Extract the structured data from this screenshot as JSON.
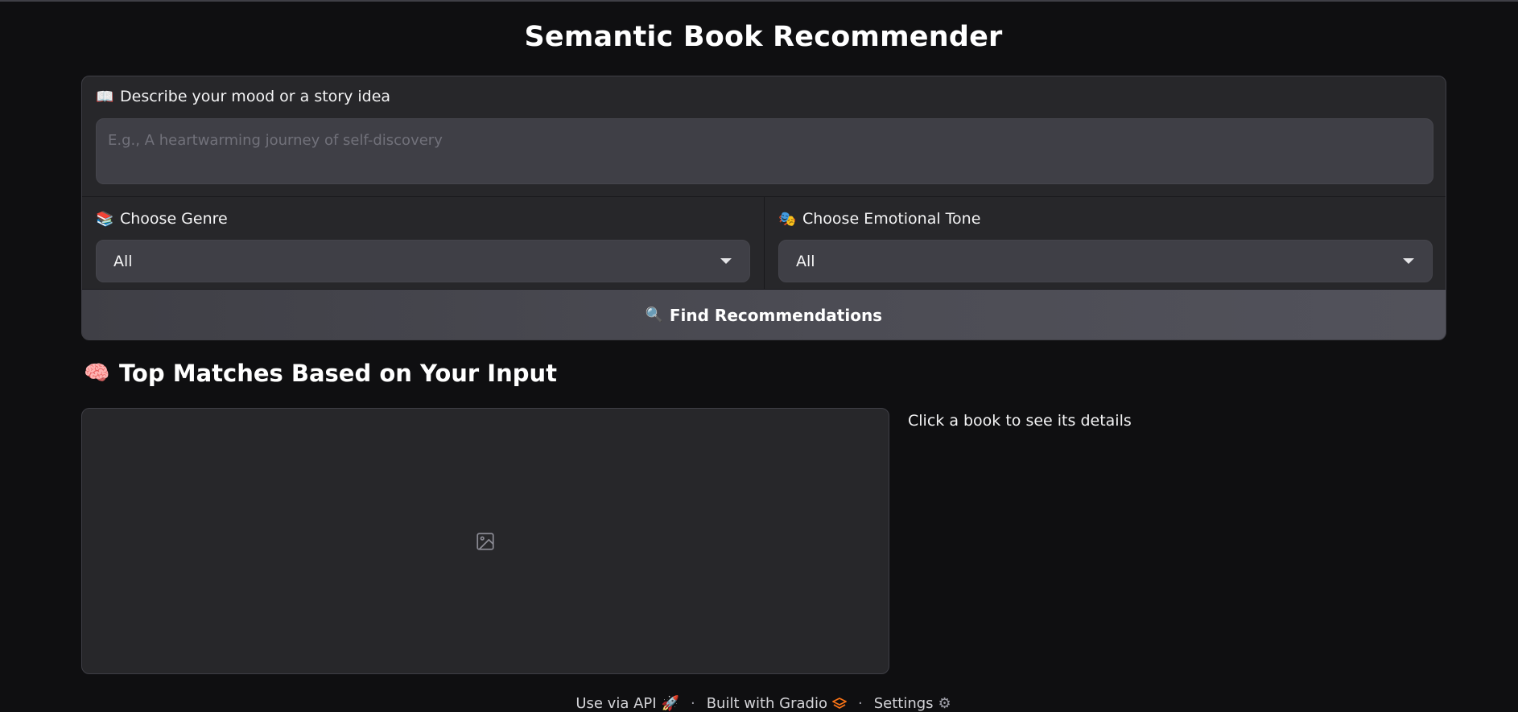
{
  "app": {
    "title": "Semantic Book Recommender"
  },
  "query": {
    "label": "Describe your mood or a story idea",
    "label_icon": "open-book",
    "placeholder": "E.g., A heartwarming journey of self-discovery",
    "value": ""
  },
  "genre": {
    "label": "Choose Genre",
    "label_icon": "books",
    "selected": "All"
  },
  "tone": {
    "label": "Choose Emotional Tone",
    "label_icon": "performing-arts",
    "selected": "All"
  },
  "actions": {
    "find_label": "Find Recommendations",
    "find_icon": "magnifying-glass"
  },
  "results": {
    "heading": "Top Matches Based on Your Input",
    "heading_icon": "brain",
    "details_hint": "Click a book to see its details"
  },
  "footer": {
    "api_label": "Use via API",
    "built_label": "Built with Gradio",
    "settings_label": "Settings",
    "separator": "·"
  },
  "colors": {
    "background": "#0f0f11",
    "panel": "#27272a",
    "input": "#3f3f46",
    "gradio_orange": "#f97316"
  }
}
